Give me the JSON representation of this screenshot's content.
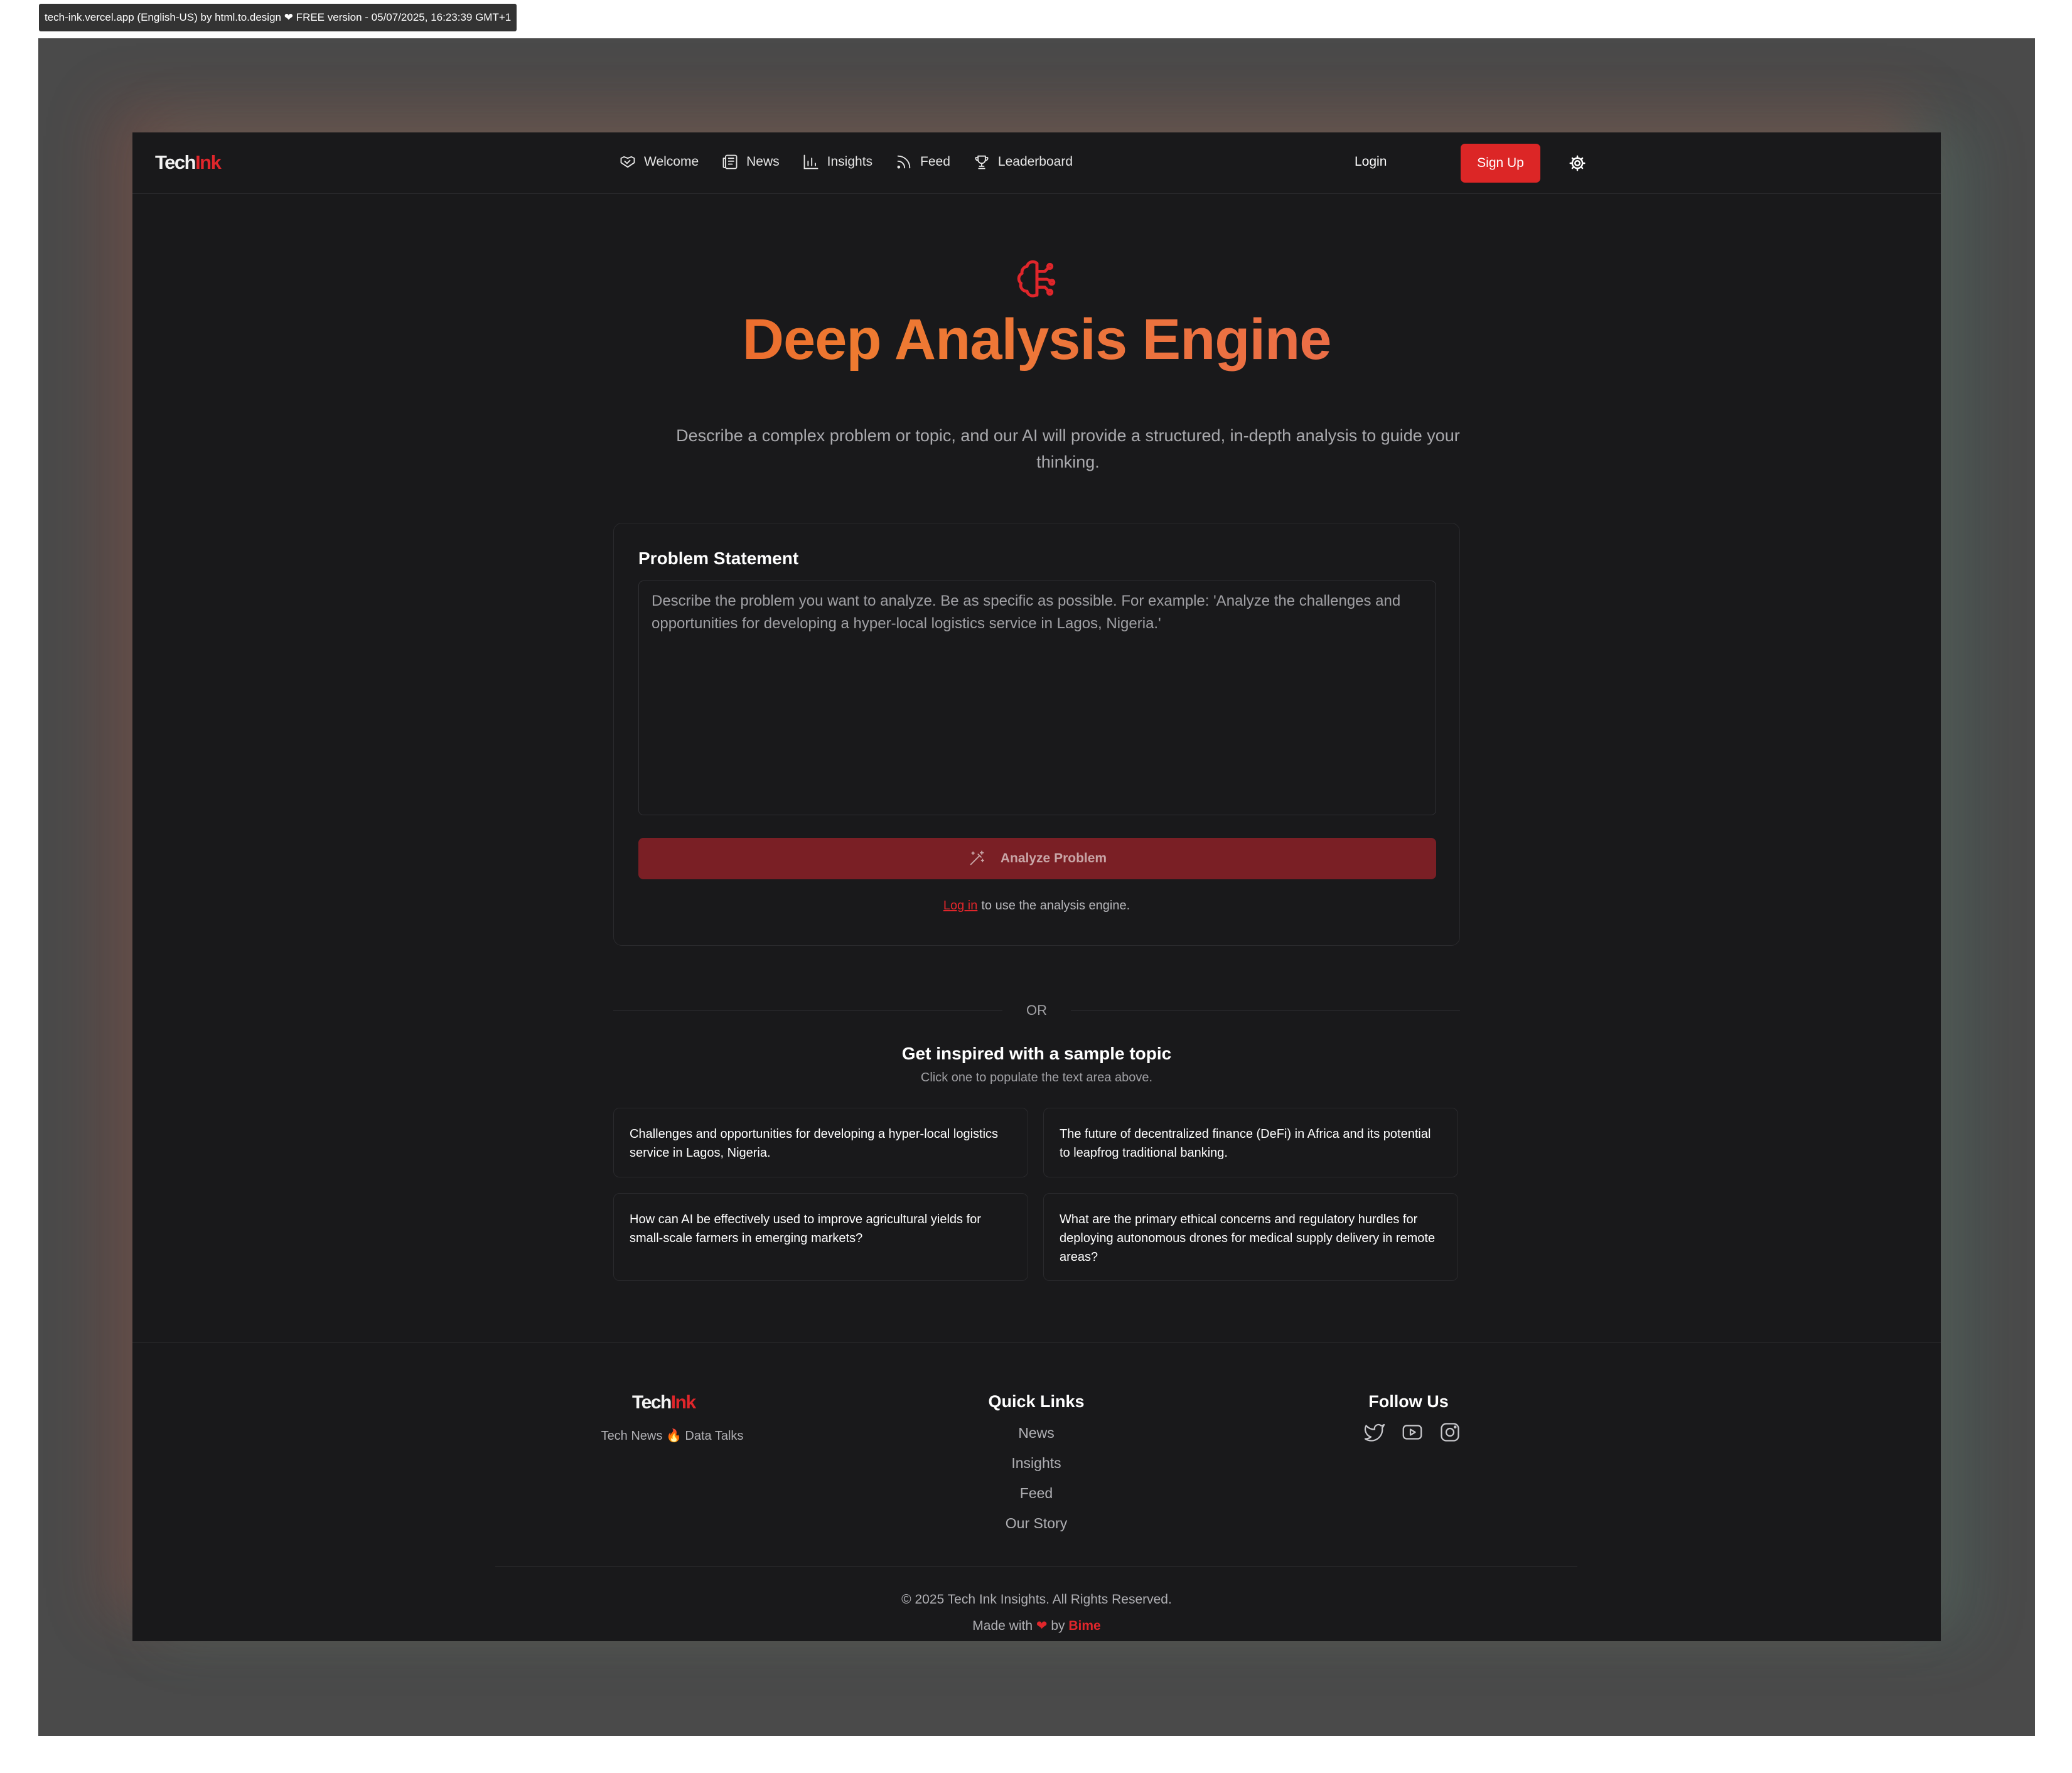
{
  "capture_label": "tech-ink.vercel.app (English-US) by html.to.design ❤ FREE version - 05/07/2025, 16:23:39 GMT+1",
  "brand": {
    "name_part1": "Tech",
    "name_part2": "Ink",
    "accent_color": "#dc2626"
  },
  "nav": {
    "items": [
      {
        "label": "Welcome",
        "icon": "handshake-icon"
      },
      {
        "label": "News",
        "icon": "newspaper-icon"
      },
      {
        "label": "Insights",
        "icon": "bar-chart-icon"
      },
      {
        "label": "Feed",
        "icon": "rss-icon"
      },
      {
        "label": "Leaderboard",
        "icon": "trophy-icon"
      }
    ],
    "login_label": "Login",
    "signup_label": "Sign Up",
    "theme_icon": "gear-icon"
  },
  "hero": {
    "icon": "brain-icon",
    "title": "Deep Analysis Engine",
    "description": "Describe a complex problem or topic, and our AI will provide a structured, in-depth analysis to guide your thinking."
  },
  "form": {
    "title": "Problem Statement",
    "value": "",
    "placeholder": "Describe the problem you want to analyze. Be as specific as possible. For example: 'Analyze the challenges and opportunities for developing a hyper-local logistics service in Lagos, Nigeria.'",
    "analyze_label": "Analyze Problem",
    "analyze_icon": "magic-wand-icon",
    "login_link": "Log in",
    "login_note": "to use the analysis engine."
  },
  "divider_label": "OR",
  "samples": {
    "title": "Get inspired with a sample topic",
    "subtitle": "Click one to populate the text area above.",
    "items": [
      "Challenges and opportunities for developing a hyper-local logistics service in Lagos, Nigeria.",
      "The future of decentralized finance (DeFi) in Africa and its potential to leapfrog traditional banking.",
      "How can AI be effectively used to improve agricultural yields for small-scale farmers in emerging markets?",
      "What are the primary ethical concerns and regulatory hurdles for deploying autonomous drones for medical supply delivery in remote areas?"
    ]
  },
  "footer": {
    "tagline_left": "Tech News",
    "tagline_icon": "🔥",
    "tagline_right": "Data Talks",
    "quick_links_title": "Quick Links",
    "quick_links": [
      "News",
      "Insights",
      "Feed",
      "Our Story"
    ],
    "follow_title": "Follow Us",
    "socials": [
      "twitter-icon",
      "youtube-icon",
      "instagram-icon"
    ],
    "copyright": "© 2025 Tech Ink Insights. All Rights Reserved.",
    "made_with": "Made with",
    "heart": "❤",
    "by": "by",
    "author": "Bime"
  }
}
